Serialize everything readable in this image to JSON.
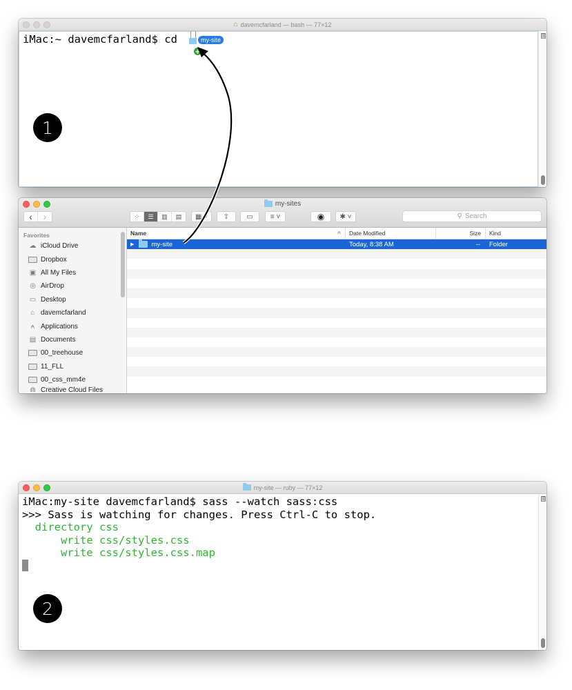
{
  "terminal1": {
    "title": "davemcfarland — bash — 77×12",
    "title_icon": "home-icon",
    "prompt_line": "iMac:~ davemcfarland$ cd ",
    "drag_label": "my-site",
    "step": "1"
  },
  "finder": {
    "title": "my-sites",
    "nav": {
      "back": "‹",
      "forward": "›"
    },
    "toolbar": {
      "view_icons": "icon-view-icon",
      "view_list": "list-view-icon",
      "view_columns": "column-view-icon",
      "view_coverflow": "coverflow-view-icon",
      "arrange": "arrange-icon",
      "share": "share-icon",
      "tags": "tag-icon",
      "sort": "sort-icon",
      "quicklook": "eye-icon",
      "action": "gear-icon"
    },
    "search_placeholder": "Search",
    "sidebar": {
      "heading": "Favorites",
      "items": [
        {
          "label": "iCloud Drive",
          "icon": "cloud-icon"
        },
        {
          "label": "Dropbox",
          "icon": "folder-icon"
        },
        {
          "label": "All My Files",
          "icon": "all-files-icon"
        },
        {
          "label": "AirDrop",
          "icon": "airdrop-icon"
        },
        {
          "label": "Desktop",
          "icon": "desktop-icon"
        },
        {
          "label": "davemcfarland",
          "icon": "home-icon"
        },
        {
          "label": "Applications",
          "icon": "applications-icon"
        },
        {
          "label": "Documents",
          "icon": "documents-icon"
        },
        {
          "label": "00_treehouse",
          "icon": "folder-icon"
        },
        {
          "label": "11_FLL",
          "icon": "folder-icon"
        },
        {
          "label": "00_css_mm4e",
          "icon": "folder-icon"
        },
        {
          "label": "Creative Cloud Files",
          "icon": "creative-cloud-icon"
        }
      ]
    },
    "columns": {
      "name": "Name",
      "sort_indicator": "^",
      "date": "Date Modified",
      "size": "Size",
      "kind": "Kind"
    },
    "rows": [
      {
        "name": "my-site",
        "date": "Today, 8:38 AM",
        "size": "--",
        "kind": "Folder",
        "selected": true
      }
    ]
  },
  "terminal2": {
    "title": "my-site — ruby — 77×12",
    "title_icon": "folder-icon",
    "lines": [
      {
        "text": "iMac:my-site davemcfarland$ sass --watch sass:css",
        "color": "#000000"
      },
      {
        "text": ">>> Sass is watching for changes. Press Ctrl-C to stop.",
        "color": "#000000"
      },
      {
        "text": "  directory css",
        "color": "#2fb52f"
      },
      {
        "text": "      write css/styles.css",
        "color": "#2fb52f"
      },
      {
        "text": "      write css/styles.css.map",
        "color": "#2fb52f"
      }
    ],
    "step": "2"
  },
  "colors": {
    "selection": "#1a65d6",
    "output_green": "#2fb52f",
    "drag_pill": "#2b7ce0"
  }
}
